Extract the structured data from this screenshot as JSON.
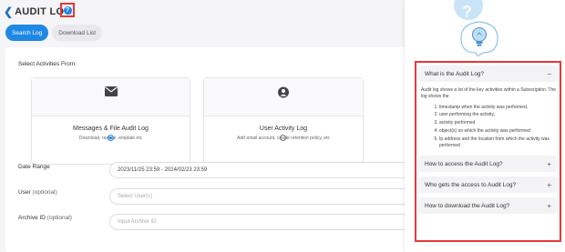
{
  "header": {
    "back_icon": "chevron-left-icon",
    "title": "AUDIT LOG",
    "help_glyph": "?"
  },
  "tabs": [
    {
      "label": "Search Log",
      "active": true
    },
    {
      "label": "Download List",
      "active": false
    }
  ],
  "main": {
    "select_label": "Select Activities From:",
    "cards": [
      {
        "icon": "envelope-icon",
        "title": "Messages & File Audit Log",
        "subtitle": "Download, restore, emplate etc",
        "selected": true
      },
      {
        "icon": "user-icon",
        "title": "User Activity Log",
        "subtitle": "Add email account, create retention policy, etc",
        "selected": false
      }
    ],
    "fields": {
      "date_range": {
        "label": "Date Range",
        "value": "2023/11/25 23:59 - 2024/02/23 23:59"
      },
      "user": {
        "label": "User",
        "optional": "(optional)",
        "placeholder": "Select User(s)"
      },
      "archive_id": {
        "label": "Archive ID",
        "optional": "(optional)",
        "placeholder": "Input Archive ID"
      }
    }
  },
  "drawer": {
    "illustration": "question-bulb-illustration",
    "faq": [
      {
        "question": "What is the Audit Log?",
        "expanded": true,
        "toggle": "−",
        "answer_intro": "Audit log shows a lot of the key activities within a Subscription. The log shows the",
        "answer_items": [
          "timestamp when the activity was performed,",
          "user performing the activity,",
          "activity performed",
          "object(s) on which the activity was performed",
          "Ip address and the location from which the activity was performed"
        ]
      },
      {
        "question": "How to access the Audit Log?",
        "expanded": false,
        "toggle": "+"
      },
      {
        "question": "Who gets the access to Audit Log?",
        "expanded": false,
        "toggle": "+"
      },
      {
        "question": "How to download the Audit Log?",
        "expanded": false,
        "toggle": "+"
      }
    ]
  },
  "colors": {
    "accent": "#1e88e5",
    "highlight_border": "#e53935"
  }
}
